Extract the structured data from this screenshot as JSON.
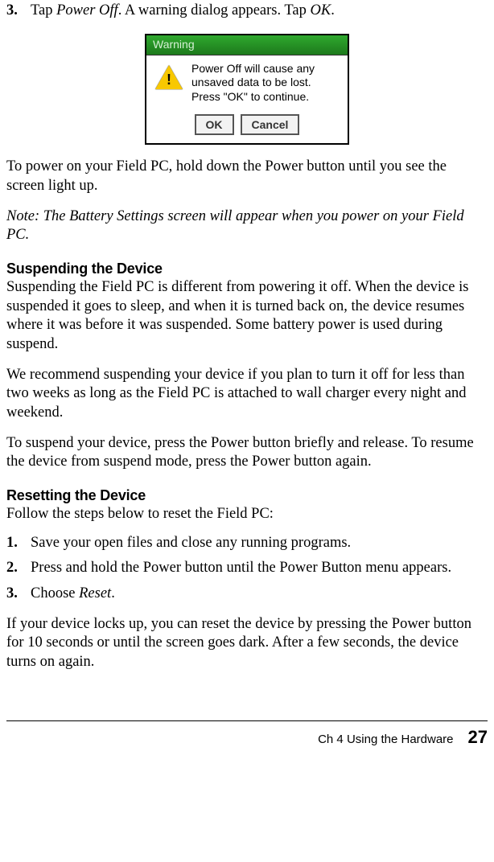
{
  "step3": {
    "num": "3.",
    "text_a": "Tap ",
    "text_b": "Power Off",
    "text_c": ". A warning dialog appears. Tap ",
    "text_d": "OK",
    "text_e": "."
  },
  "dialog": {
    "title": "Warning",
    "line1": "Power Off will cause any",
    "line2": "unsaved data to be lost.",
    "line3": "Press \"OK\" to continue.",
    "ok": "OK",
    "cancel": "Cancel"
  },
  "para_power_on": "To power on your Field PC, hold down the Power button until you see the screen light up.",
  "note": "Note: The Battery Settings screen will appear when you power on your Field PC.",
  "heading_suspend": "Suspending the Device",
  "suspend_p1": "Suspending the Field PC is different from powering it off. When the device is suspended it goes to sleep, and when it is turned back on, the device resumes where it was before it was suspended. Some battery power is used during suspend.",
  "suspend_p2": "We recommend suspending your device if you plan to turn it off for less than two weeks as long as the Field PC is attached to wall charger every night and weekend.",
  "suspend_p3": "To suspend your device, press the Power button briefly and release. To resume the device from suspend mode, press the Power button again.",
  "heading_reset": "Resetting the Device",
  "reset_intro": "Follow the steps below to reset the Field PC:",
  "reset_steps": {
    "s1": {
      "num": "1.",
      "text": "Save your open files and close any running programs."
    },
    "s2": {
      "num": "2.",
      "text": "Press and hold the Power button until the Power Button menu appears."
    },
    "s3": {
      "num": "3.",
      "text_a": "Choose ",
      "text_b": "Reset",
      "text_c": "."
    }
  },
  "reset_outro": "If your device locks up, you can reset the device by pressing the Power button for 10 seconds or until the screen goes dark. After a few seconds, the device turns on again.",
  "footer": {
    "chapter": "Ch 4    Using the Hardware",
    "page": "27"
  }
}
